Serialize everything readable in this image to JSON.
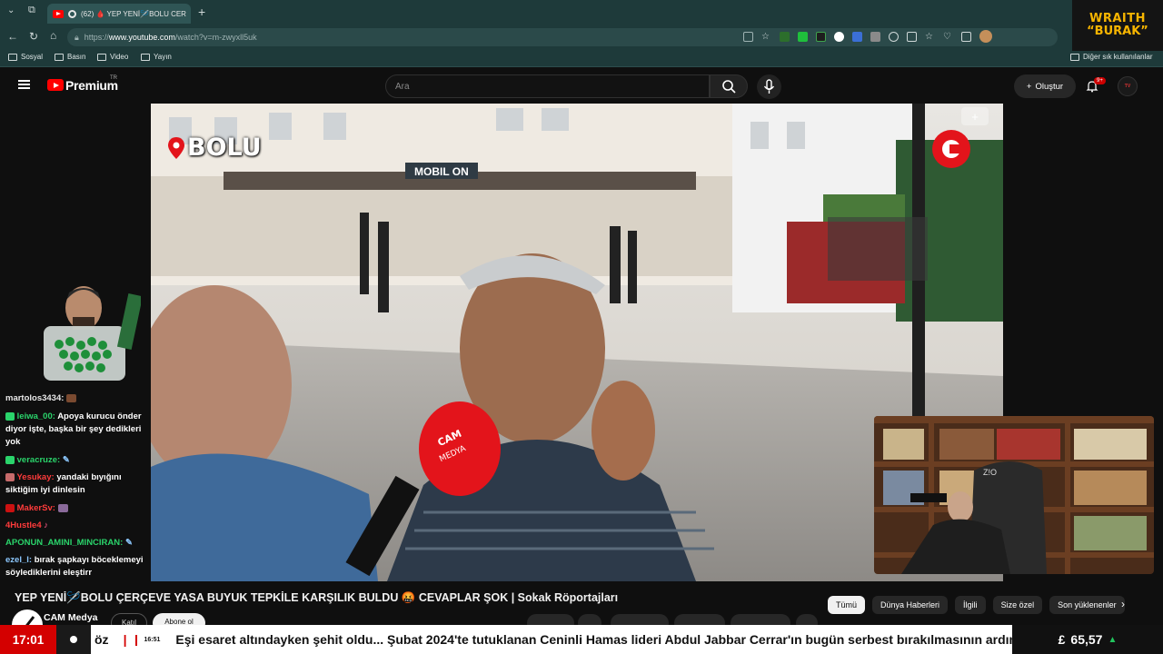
{
  "browser": {
    "tab_title": "(62) 🩸 YEP YENİ🪡BOLU CER",
    "url_prefix": "https://",
    "url_host": "www.youtube.com",
    "url_path": "/watch?v=m-zwyxll5uk",
    "bookmarks": [
      "Sosyal",
      "Basın",
      "Video",
      "Yayın"
    ],
    "other_bookmarks": "Diğer sık kullanılanlar"
  },
  "overlay": {
    "line1": "WRAITH",
    "line2": "“BURAK”"
  },
  "youtube": {
    "brand": "Premium",
    "country": "TR",
    "search_placeholder": "Ara",
    "create_label": "Oluştur",
    "notif_count": "9+"
  },
  "chat": {
    "messages": [
      {
        "user": "martolos3434:",
        "text": "",
        "user_color": "white"
      },
      {
        "user": "leiwa_00:",
        "text": "Apoya kurucu önder diyor işte, başka bir şey dedikleri yok",
        "user_color": "green"
      },
      {
        "user": "veracruze:",
        "text": "",
        "user_color": "green"
      },
      {
        "user": "Yesukay:",
        "text": "yandaki bıyığını siktiğim iyi dinlesin",
        "user_color": "red"
      },
      {
        "user": "MakerSv:",
        "text": "",
        "user_color": "red"
      },
      {
        "user": "4Hustle4",
        "text": "",
        "user_color": "red"
      },
      {
        "user": "APONUN_AMINI_MINCIRAN:",
        "text": "",
        "user_color": "green"
      },
      {
        "user": "ezel_l:",
        "text": "bırak şapkayı böceklemeyi söylediklerini eleştirr",
        "user_color": "blue"
      }
    ]
  },
  "video": {
    "location_tag": "BOLU"
  },
  "watch": {
    "title": "YEP YENİ🪡BOLU ÇERÇEVE YASA BUYUK TEPKİLE KARŞILIK BULDU 🤬 CEVAPLAR ŞOK | Sokak Röportajları",
    "channel": "CAM Medya",
    "join": "Katıl",
    "subscribe": "Abone ol",
    "chips": [
      "Tümü",
      "Dünya Haberleri",
      "İlgili",
      "Size özel",
      "Son yüklenenler"
    ]
  },
  "ticker": {
    "clock": "17:01",
    "text_start": "öz",
    "item_time": "16:51",
    "text": "Eşi esaret altındayken şehit oldu... Şubat 2024'te tutuklanan Ceninli Hamas lideri Abdul Jabbar Cerrar'ın bugün serbest bırakılmasının ardından",
    "fx_symbol": "£",
    "fx_value": "65,57"
  },
  "colors": {
    "accent_red": "#d40000",
    "yt_red": "#ff0000",
    "overlay_gold": "#f7b500"
  }
}
